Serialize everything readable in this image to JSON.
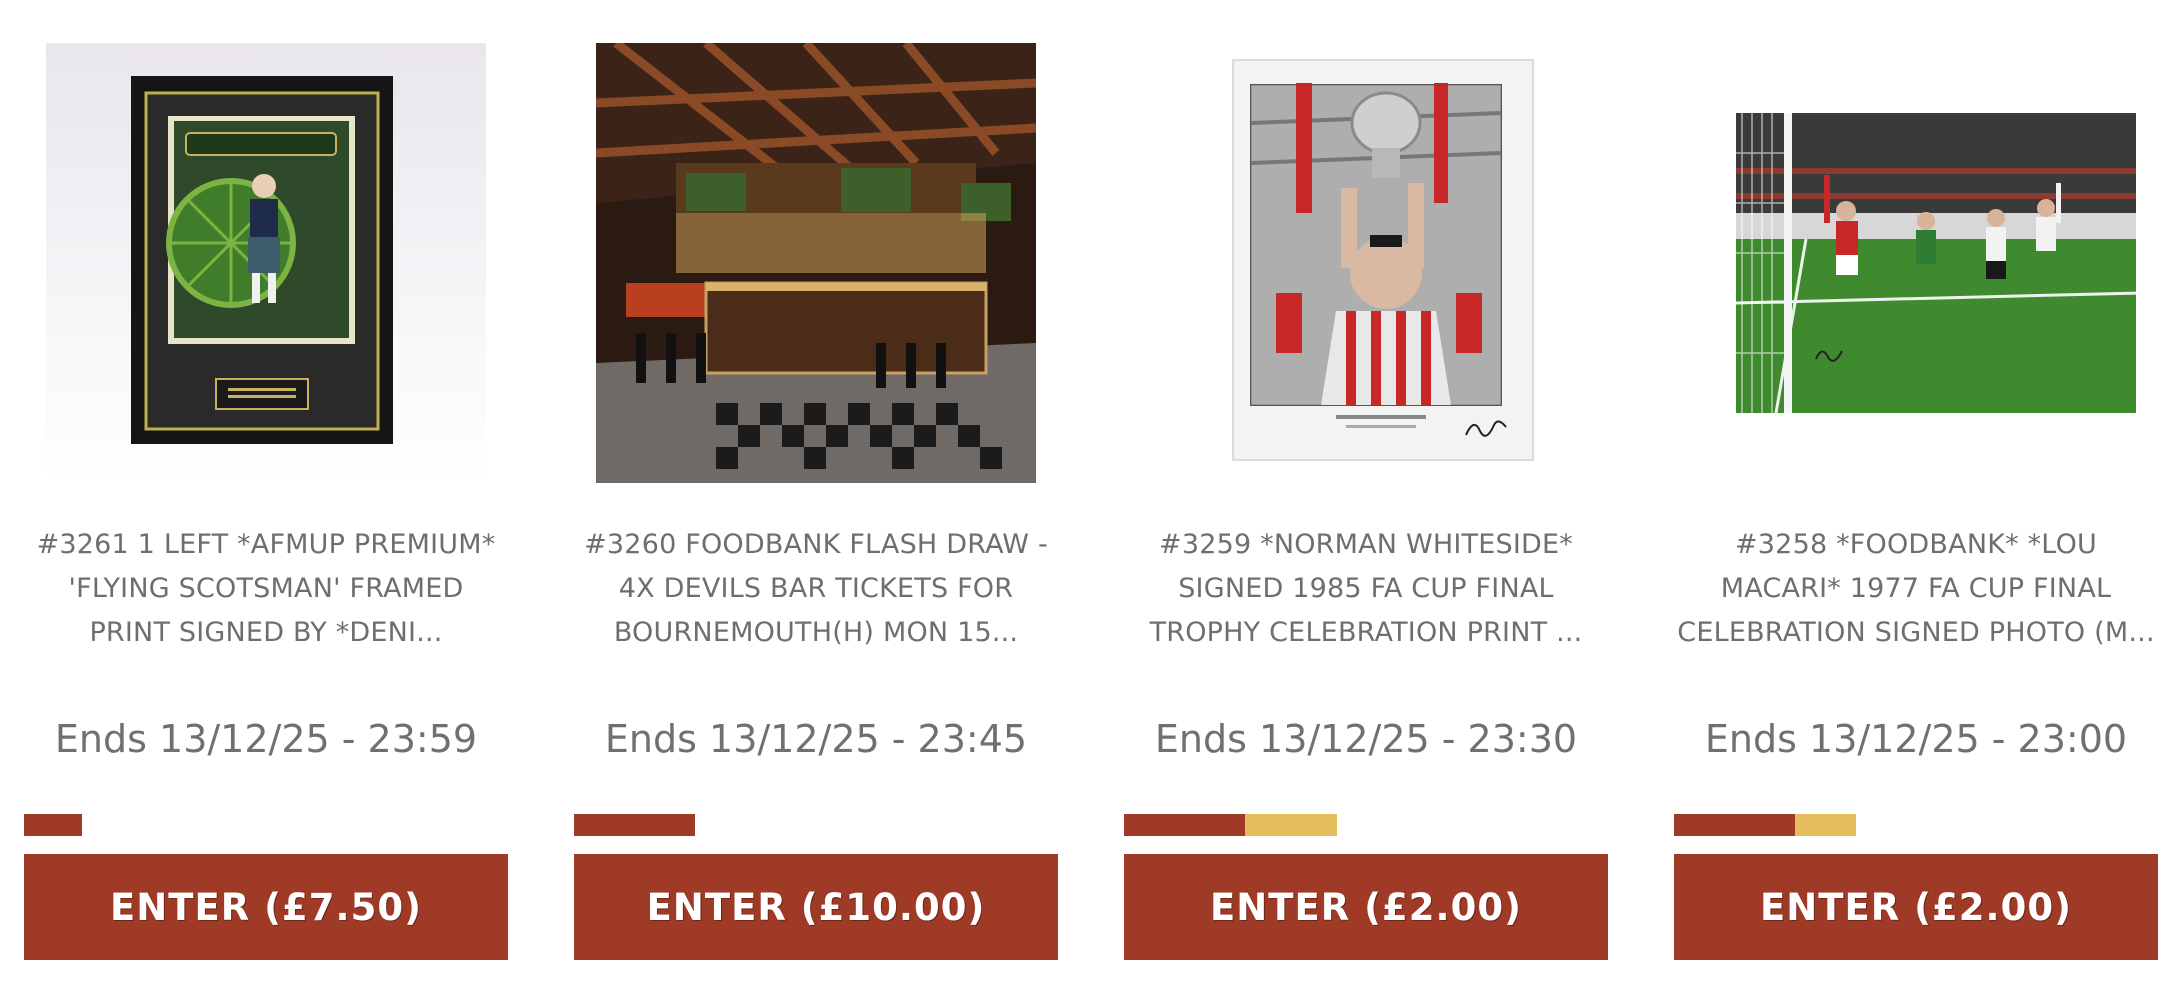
{
  "colors": {
    "accent": "#9e3a26",
    "reserved": "#e6bd5c",
    "text": "#6e6e6e"
  },
  "cards": [
    {
      "title": "#3261 1 LEFT *AFMUP PREMIUM* 'FLYING SCOTSMAN' FRAMED PRINT SIGNED BY *DENI...",
      "ends": "Ends 13/12/25 - 23:59",
      "button": "ENTER (£7.50)",
      "image": "framed-flying-scotsman-print",
      "sold_fraction": 0.12,
      "reserved_fraction": 0.0
    },
    {
      "title": "#3260 FOODBANK FLASH DRAW - 4X DEVILS BAR TICKETS FOR BOURNEMOUTH(H) MON 15...",
      "ends": "Ends 13/12/25 - 23:45",
      "button": "ENTER (£10.00)",
      "image": "devils-bar-interior",
      "sold_fraction": 0.25,
      "reserved_fraction": 0.0
    },
    {
      "title": "#3259 *NORMAN WHITESIDE* SIGNED 1985 FA CUP FINAL TROPHY CELEBRATION PRINT ...",
      "ends": "Ends 13/12/25 - 23:30",
      "button": "ENTER (£2.00)",
      "image": "norman-whiteside-trophy-print",
      "sold_fraction": 0.25,
      "reserved_fraction": 0.19
    },
    {
      "title": "#3258 *FOODBANK* *LOU MACARI* 1977 FA CUP FINAL CELEBRATION SIGNED PHOTO (M...",
      "ends": "Ends 13/12/25 - 23:00",
      "button": "ENTER (£2.00)",
      "image": "lou-macari-celebration-photo",
      "sold_fraction": 0.25,
      "reserved_fraction": 0.125
    }
  ]
}
